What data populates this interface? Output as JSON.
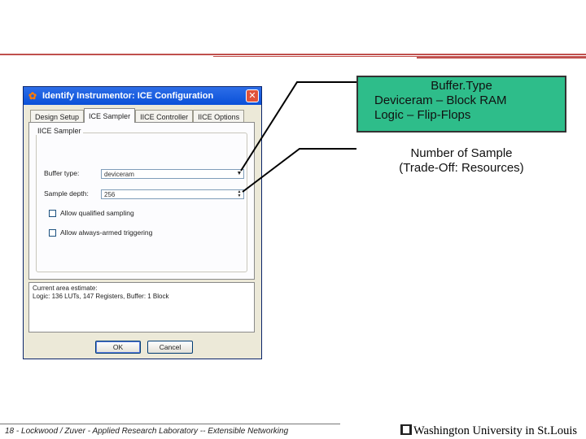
{
  "dialog": {
    "title": "Identify Instrumentor: ICE Configuration",
    "close_glyph": "✕",
    "tabs": [
      {
        "label": "Design Setup"
      },
      {
        "label": "ICE Sampler"
      },
      {
        "label": "IICE Controller"
      },
      {
        "label": "IICE Options"
      }
    ],
    "group_title": "IICE Sampler",
    "buffer_type_label": "Buffer type:",
    "buffer_type_value": "deviceram",
    "sample_depth_label": "Sample depth:",
    "sample_depth_value": "256",
    "allow_qualified_label": "Allow qualified sampling",
    "allow_always_armed_label": "Allow always-armed triggering",
    "estimate_line1": "Current area estimate:",
    "estimate_line2": "Logic: 136 LUTs, 147 Registers, Buffer: 1 Block",
    "ok_label": "OK",
    "cancel_label": "Cancel"
  },
  "callouts": {
    "buffer": {
      "line1": "Buffer.Type",
      "line2": "Deviceram – Block RAM",
      "line3": "Logic – Flip-Flops"
    },
    "sample": {
      "line1": "Number of Sample",
      "line2": "(Trade-Off: Resources)"
    }
  },
  "footer": {
    "left_text": "18 - Lockwood / Zuver - Applied Research Laboratory -- Extensible Networking",
    "logo_text": "Washington University in St.Louis"
  },
  "colors": {
    "accent_line": "#c0504d",
    "callout_fill": "#2ebd8a",
    "titlebar": "#0a50d8"
  }
}
